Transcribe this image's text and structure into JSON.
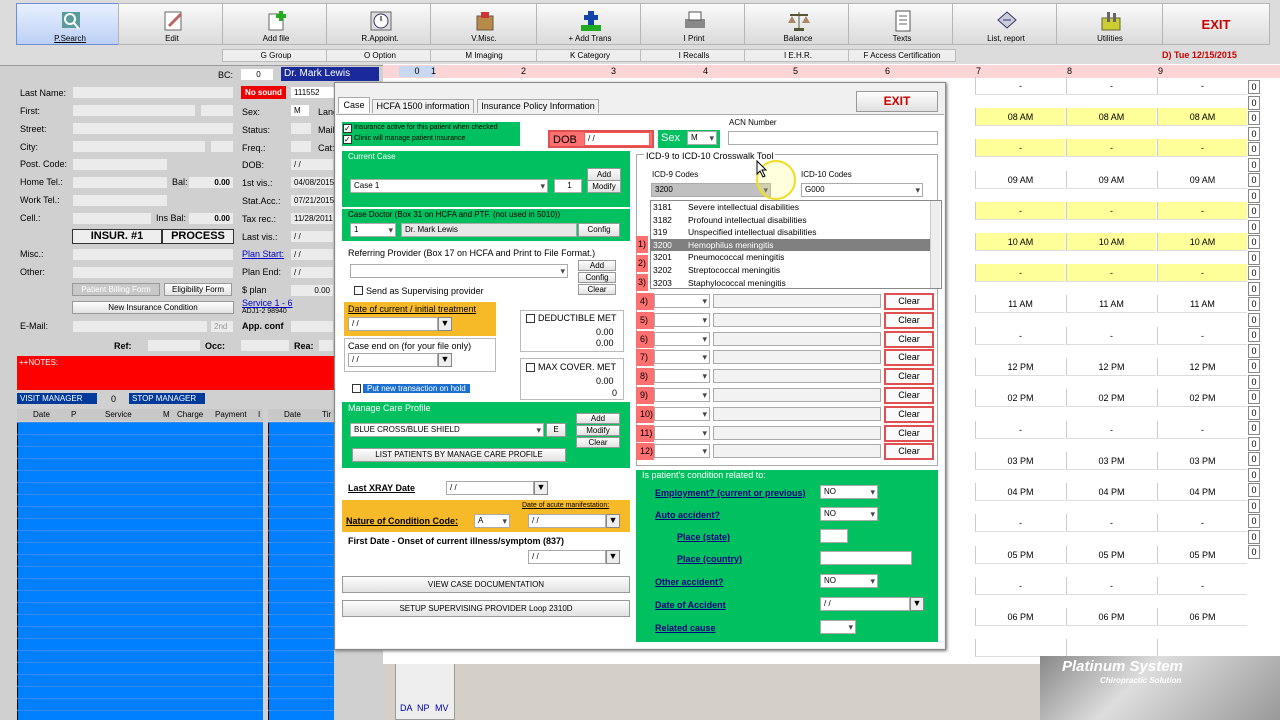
{
  "toolbar": {
    "buttons": [
      "P.Search",
      "Edit",
      "Add file",
      "R.Appoint.",
      "V.Misc.",
      "+ Add Trans",
      "I Print",
      "Balance",
      "Texts",
      "List, report",
      "Utilities"
    ],
    "exit": "EXIT",
    "secondary": [
      "G Group",
      "O Option",
      "M Imaging",
      "K Category",
      "I Recalls",
      "I E.H.R.",
      "F Access Certification"
    ],
    "date": "D) Tue 12/15/2015"
  },
  "patient": {
    "bc_label": "BC:",
    "bc": "0",
    "doctor": "Dr. Mark Lewis",
    "sound": "No sound",
    "id": "111552",
    "labels": [
      "Last Name:",
      "First:",
      "Street:",
      "City:",
      "Post. Code:",
      "Home Tel.:",
      "Work Tel.:",
      "Cell.:",
      "Misc.:",
      "Other:",
      "E-Mail:"
    ],
    "right_labels": [
      "Sex:",
      "Status:",
      "Freq.:",
      "DOB:",
      "1st vis.:",
      "Stat.Acc.:",
      "Tax rec.:",
      "Last vis.:",
      "Plan Start:",
      "Plan End:",
      "$ plan",
      "Service 1 - 6",
      "App. conf"
    ],
    "right_values": [
      "M",
      "",
      "",
      "/ /",
      "04/08/2015",
      "07/21/2015",
      "11/28/2011",
      "/ /",
      "/ /",
      "/ /",
      "0.00",
      "ADJ1-2 98940",
      ""
    ],
    "lang": "Lang",
    "mail": "Mail",
    "cat": "Cat:",
    "bal_label": "Bal:",
    "bal": "0.00",
    "insbal_label": "Ins Bal:",
    "insbal": "0.00",
    "insur": "INSUR. #1",
    "process": "PROCESS",
    "billing": "Patient Billing Form",
    "eligibility": "Eligibility Form",
    "new_ins": "New Insurance Condition",
    "second": "2nd",
    "ref": "Ref:",
    "occ": "Occ:",
    "rea": "Rea:",
    "notes": "++NOTES:",
    "visit_mgr": "VISIT MANAGER",
    "visit_count": "0",
    "stop_mgr": "STOP MANAGER",
    "cols": [
      "Date",
      "P",
      "Service",
      "M",
      "Charge",
      "Payment",
      "I"
    ],
    "cols2": [
      "Date",
      "Tir"
    ],
    "bottom_tags": [
      "DA",
      "NP",
      "MV"
    ]
  },
  "schedule": {
    "headers": [
      "0",
      "1",
      "2",
      "3",
      "4",
      "5",
      "6",
      "7",
      "8",
      "9"
    ],
    "times": [
      "08 AM",
      "-",
      "09 AM",
      "-",
      "10 AM",
      "-",
      "11 AM",
      "-",
      "12 PM",
      "-",
      "02 PM",
      "-",
      "03 PM",
      "-",
      "04 PM",
      "-",
      "05 PM",
      "-",
      "06 PM"
    ],
    "zero": "0",
    "brand": "Platinum System",
    "brand_sub": "Chiropractic Solution"
  },
  "dialog": {
    "tabs": [
      "Case",
      "HCFA 1500 information",
      "Insurance Policy Information"
    ],
    "exit": "EXIT",
    "ins_active": "Insurance active for this patient when checked",
    "clinic": "Clinic will manage patient insurance",
    "dob_label": "DOB",
    "dob": "/ /",
    "sex_label": "Sex",
    "sex": "M",
    "acn_label": "ACN Number",
    "current_case": "Current Case",
    "case": "Case 1",
    "case_num": "1",
    "add": "Add",
    "modify": "Modify",
    "case_doctor": "Case Doctor (Box 31 on HCFA and PTF. (not used in 5010))",
    "doc_num": "1",
    "doc_name": "Dr. Mark Lewis",
    "config": "Config",
    "referring": "Referring Provider (Box 17 on HCFA and Print to File Format.)",
    "clear": "Clear",
    "send_sup": "Send as Supervising provider",
    "date_current": "Date of current / initial treatment",
    "date_current_val": "/ /",
    "case_end": "Case end on (for your file only)",
    "case_end_val": "/ /",
    "deductible": "DEDUCTIBLE MET",
    "ded1": "0.00",
    "ded2": "0.00",
    "maxcover": "MAX COVER. MET",
    "max1": "0.00",
    "max2": "0",
    "put_hold": "Put new transaction on hold",
    "manage_care": "Manage Care Profile",
    "mcp": "BLUE CROSS/BLUE SHIELD",
    "e": "E",
    "list_mcp": "LIST PATIENTS BY MANAGE CARE PROFILE",
    "last_xray": "Last XRAY Date",
    "last_xray_val": "/ /",
    "acute": "Date of acute manifestation:",
    "nature": "Nature of Condition Code:",
    "nature_val": "A",
    "acute_val": "/ /",
    "first_date": "First Date - Onset of current illness/symptom (837)",
    "first_date_val": "/ /",
    "view_doc": "VIEW CASE DOCUMENTATION",
    "setup_sup": "SETUP SUPERVISING PROVIDER Loop 2310D",
    "crosswalk": "ICD-9 to ICD-10 Crosswalk Tool",
    "icd9_label": "ICD-9 Codes",
    "icd9_val": "3200",
    "icd10_label": "ICD-10 Codes",
    "icd10_val": "G000",
    "icd_list": [
      [
        "3181",
        "Severe intellectual disabilities"
      ],
      [
        "3182",
        "Profound intellectual disabilities"
      ],
      [
        "319",
        "Unspecified intellectual disabilities"
      ],
      [
        "3200",
        "Hemophilus meningitis"
      ],
      [
        "3201",
        "Pneumococcal meningitis"
      ],
      [
        "3202",
        "Streptococcal meningitis"
      ],
      [
        "3203",
        "Staphylococcal meningitis"
      ]
    ],
    "diag_rows": [
      "1)",
      "2)",
      "3)",
      "4)",
      "5)",
      "6)",
      "7)",
      "8)",
      "9)",
      "10)",
      "11)",
      "12)"
    ],
    "condition": "Is patient's condition related to:",
    "employment": "Employment? (current or previous)",
    "employment_val": "NO",
    "auto": "Auto accident?",
    "auto_val": "NO",
    "place_state": "Place (state)",
    "place_country": "Place (country)",
    "other_acc": "Other accident?",
    "other_val": "NO",
    "date_acc": "Date of Accident",
    "date_acc_val": "/ /",
    "related": "Related cause"
  }
}
